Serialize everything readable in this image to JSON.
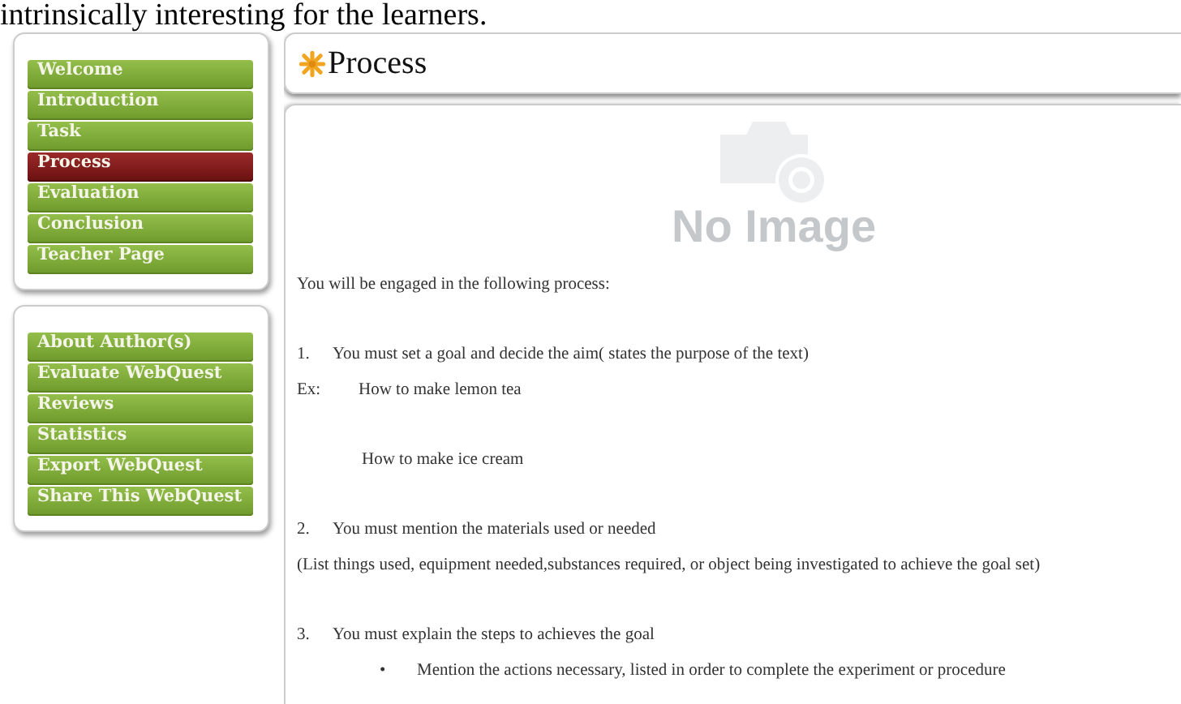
{
  "top_text": "intrinsically interesting for the learners.",
  "sidebar": {
    "menus": [
      {
        "items": [
          {
            "label": "Welcome",
            "selected": false
          },
          {
            "label": "Introduction",
            "selected": false
          },
          {
            "label": "Task",
            "selected": false
          },
          {
            "label": "Process",
            "selected": true
          },
          {
            "label": "Evaluation",
            "selected": false
          },
          {
            "label": "Conclusion",
            "selected": false
          },
          {
            "label": "Teacher Page",
            "selected": false
          }
        ]
      },
      {
        "items": [
          {
            "label": "About Author(s)",
            "selected": false
          },
          {
            "label": "Evaluate WebQuest",
            "selected": false
          },
          {
            "label": "Reviews",
            "selected": false
          },
          {
            "label": "Statistics",
            "selected": false
          },
          {
            "label": "Export WebQuest",
            "selected": false
          },
          {
            "label": "Share This WebQuest",
            "selected": false
          }
        ]
      }
    ]
  },
  "page_title": "Process",
  "image_placeholder": {
    "label": "No Image"
  },
  "content": [
    {
      "kind": "paragraph",
      "text": "You will be engaged in the following process:"
    },
    {
      "kind": "numbered",
      "marker": "1.",
      "text": "You must set a goal and decide the aim( states the purpose of the text)"
    },
    {
      "kind": "example",
      "marker": "Ex:",
      "text": "How to make lemon tea"
    },
    {
      "kind": "indented",
      "text": "How to make ice cream"
    },
    {
      "kind": "numbered",
      "marker": "2.",
      "text": "You must mention the materials used or needed"
    },
    {
      "kind": "paragraph",
      "text": "(List things used, equipment needed,substances required, or object being investigated to achieve the goal set)"
    },
    {
      "kind": "numbered",
      "marker": "3.",
      "text": "You must explain the steps to achieves the goal"
    },
    {
      "kind": "bullet",
      "marker": "•",
      "text": "Mention the actions necessary, listed in order to complete the experiment or procedure"
    }
  ]
}
